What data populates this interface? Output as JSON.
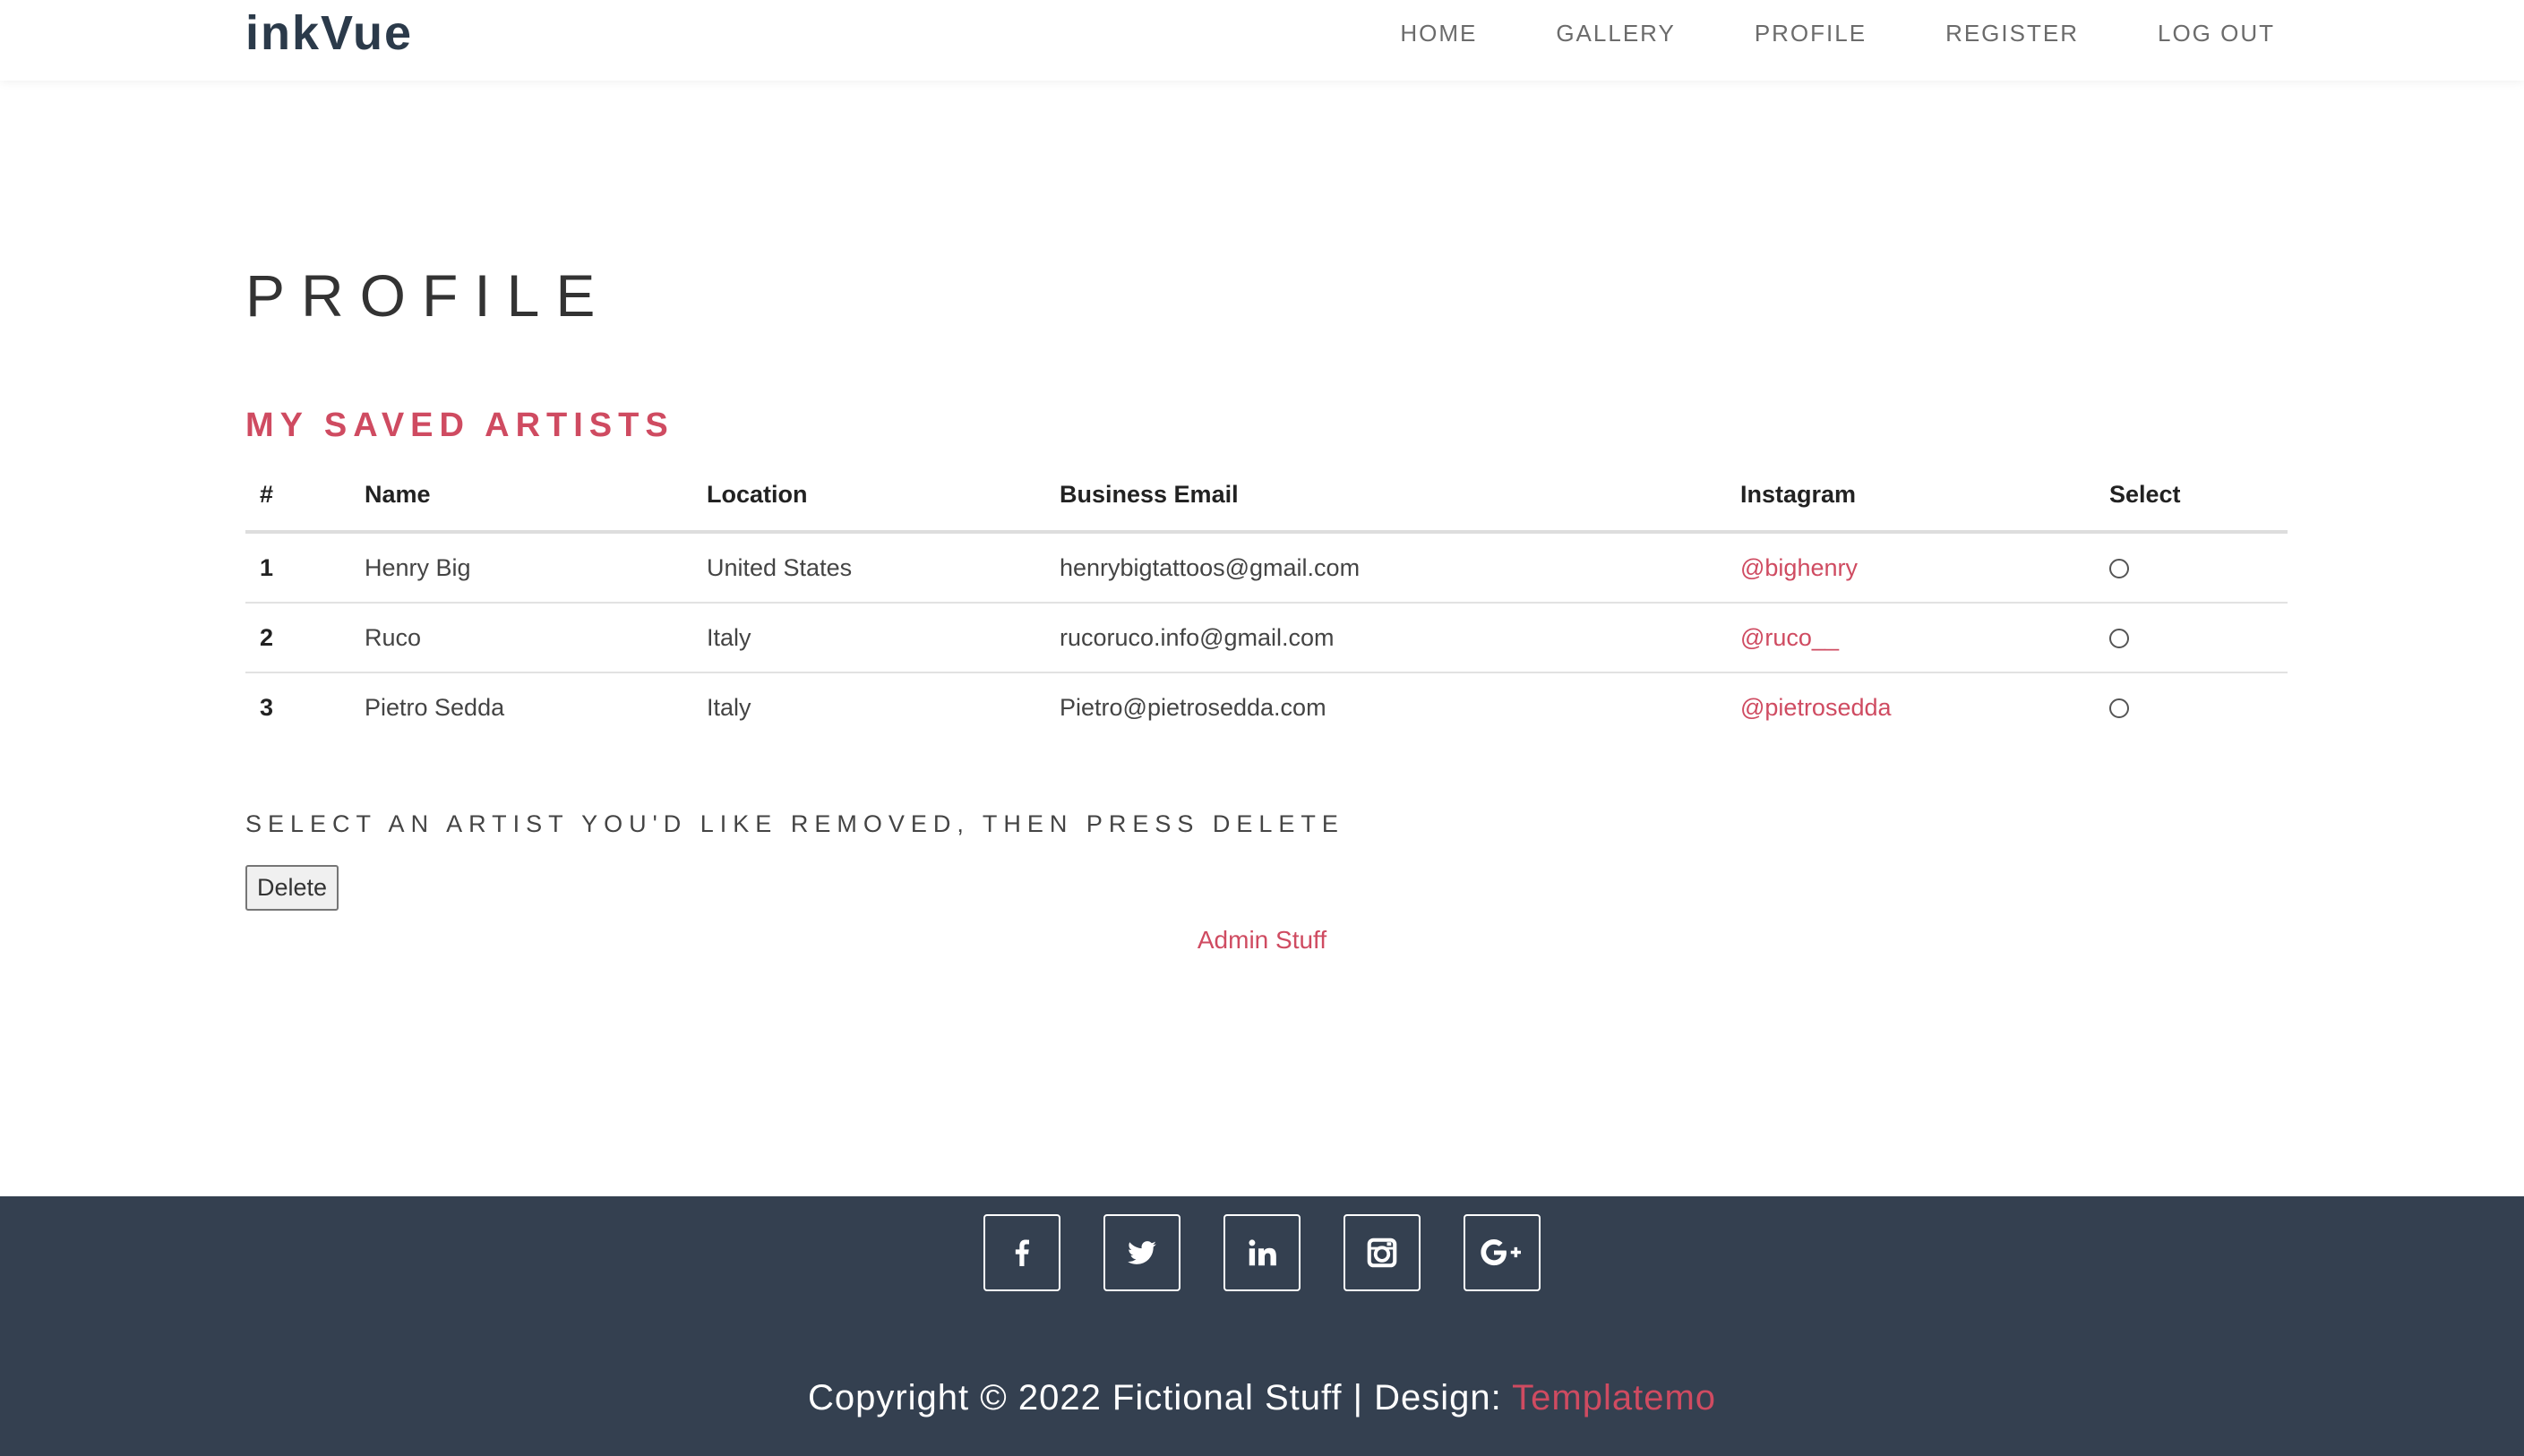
{
  "brand": {
    "name": "inkVue"
  },
  "nav": {
    "items": [
      {
        "label": "HOME"
      },
      {
        "label": "GALLERY"
      },
      {
        "label": "PROFILE"
      },
      {
        "label": "REGISTER"
      },
      {
        "label": "LOG OUT"
      }
    ]
  },
  "page": {
    "title": "PROFILE",
    "section_title": "MY SAVED ARTISTS"
  },
  "table": {
    "headers": [
      "#",
      "Name",
      "Location",
      "Business Email",
      "Instagram",
      "Select"
    ],
    "rows": [
      {
        "num": "1",
        "name": "Henry Big",
        "location": "United States",
        "email": "henrybigtattoos@gmail.com",
        "instagram": "@bighenry"
      },
      {
        "num": "2",
        "name": "Ruco",
        "location": "Italy",
        "email": "rucoruco.info@gmail.com",
        "instagram": "@ruco__"
      },
      {
        "num": "3",
        "name": "Pietro Sedda",
        "location": "Italy",
        "email": "Pietro@pietrosedda.com",
        "instagram": "@pietrosedda"
      }
    ]
  },
  "actions": {
    "instruction": "SELECT AN ARTIST YOU'D LIKE REMOVED, THEN PRESS DELETE",
    "delete_label": "Delete",
    "admin_link": "Admin Stuff"
  },
  "footer": {
    "social": [
      {
        "icon": "facebook-icon"
      },
      {
        "icon": "twitter-icon"
      },
      {
        "icon": "linkedin-icon"
      },
      {
        "icon": "instagram-icon"
      },
      {
        "icon": "google-plus-icon"
      }
    ],
    "copyright_prefix": "Copyright © 2022 Fictional Stuff | Design: ",
    "design_link": "Templatemo"
  },
  "colors": {
    "accent": "#cf4b61",
    "footer_bg": "#344050",
    "brand": "#2b3a4a"
  }
}
